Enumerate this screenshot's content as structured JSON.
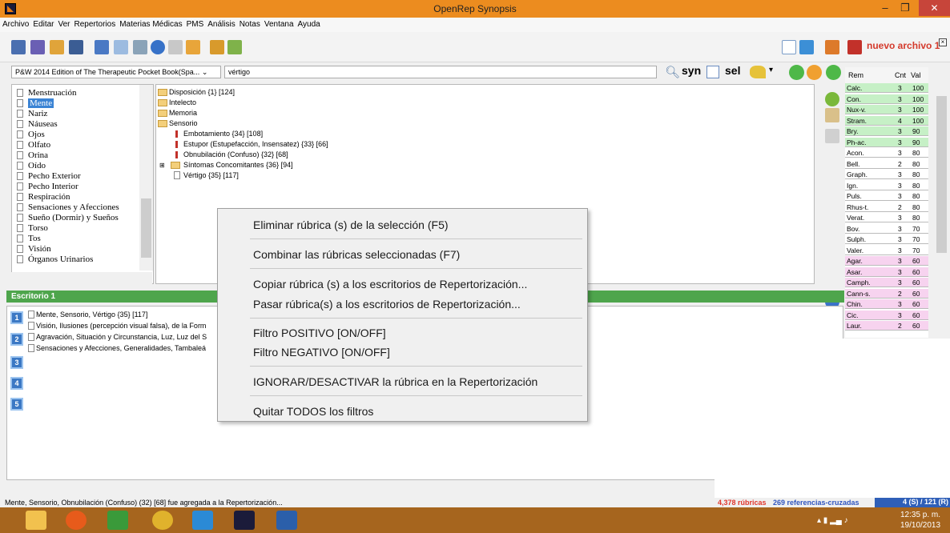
{
  "window": {
    "title": "OpenRep Synopsis",
    "min": "–",
    "max": "❐",
    "close": "✕"
  },
  "menu": [
    "Archivo",
    "Editar",
    "Ver",
    "Repertorios",
    "Materias Médicas",
    "PMS",
    "Análisis",
    "Notas",
    "Ventana",
    "Ayuda"
  ],
  "toolbar": {
    "new_file_label": "nuevo archivo 1"
  },
  "book": {
    "selected": "P&W 2014 Edition of The Therapeutic Pocket Book(Spa...",
    "search_value": "vértigo",
    "syn_label": "syn",
    "sel_label": "sel"
  },
  "chapters": [
    "Menstruación",
    "Mente",
    "Nariz",
    "Náuseas",
    "Ojos",
    "Olfato",
    "Orina",
    "Oído",
    "Pecho Exterior",
    "Pecho Interior",
    "Respiración",
    "Sensaciones y Afecciones",
    "Sueño (Dormir) y Sueños",
    "Torso",
    "Tos",
    "Visión",
    "Órganos Urinarios"
  ],
  "rubrics": [
    "Disposición {1} [124]",
    "Intelecto",
    "Memoria",
    "Sensorio",
    "Embotamiento {34} [108]",
    "Estupor (Estupefacción, Insensatez) {33} [66]",
    "Obnubilación (Confuso) {32} [68]",
    "Síntomas Concomitantes {36} [94]",
    "Vértigo {35} [117]"
  ],
  "remedies": {
    "headers": [
      "Rem",
      "Cnt",
      "Val"
    ],
    "rows": [
      [
        "Calc.",
        "3",
        "100"
      ],
      [
        "Con.",
        "3",
        "100"
      ],
      [
        "Nux-v.",
        "3",
        "100"
      ],
      [
        "Stram.",
        "4",
        "100"
      ],
      [
        "Bry.",
        "3",
        "90"
      ],
      [
        "Ph-ac.",
        "3",
        "90"
      ],
      [
        "Acon.",
        "3",
        "80"
      ],
      [
        "Bell.",
        "2",
        "80"
      ],
      [
        "Graph.",
        "3",
        "80"
      ],
      [
        "Ign.",
        "3",
        "80"
      ],
      [
        "Puls.",
        "3",
        "80"
      ],
      [
        "Rhus-t.",
        "2",
        "80"
      ],
      [
        "Verat.",
        "3",
        "80"
      ],
      [
        "Bov.",
        "3",
        "70"
      ],
      [
        "Sulph.",
        "3",
        "70"
      ],
      [
        "Valer.",
        "3",
        "70"
      ],
      [
        "Agar.",
        "3",
        "60"
      ],
      [
        "Asar.",
        "3",
        "60"
      ],
      [
        "Camph.",
        "3",
        "60"
      ],
      [
        "Cann-s.",
        "2",
        "60"
      ],
      [
        "Chin.",
        "3",
        "60"
      ],
      [
        "Cic.",
        "3",
        "60"
      ],
      [
        "Laur.",
        "2",
        "60"
      ]
    ]
  },
  "desk": {
    "title": "Escritorio 1",
    "tabs": [
      "1",
      "2",
      "3",
      "4",
      "5"
    ],
    "lines": [
      "Mente, Sensorio, Vértigo {35} [117]",
      "Visión, Ilusiones (percepción visual falsa), de la Form",
      "Agravación, Situación y Circunstancia, Luz, Luz del S",
      "Sensaciones y Afecciones, Generalidades, Tambaleá"
    ]
  },
  "context_menu": [
    "Eliminar rúbrica (s) de la selección (F5)",
    "Combinar las rúbricas seleccionadas (F7)",
    "Copiar rúbrica (s) a los escritorios de Repertorización...",
    "Pasar rúbrica(s) a los escritorios de Repertorización...",
    "Filtro POSITIVO [ON/OFF]",
    "Filtro NEGATIVO [ON/OFF]",
    "IGNORAR/DESACTIVAR la rúbrica en la Repertorización",
    "Quitar TODOS los filtros"
  ],
  "status": {
    "message": "Mente, Sensorio, Obnubilación (Confuso) (32) [68] fue agregada a la Repertorización...",
    "rubricas": "4,378 rúbricas",
    "referencias": "269 referencias-cruzadas",
    "count": "4 (S) / 121 (R)"
  },
  "taskbar": {
    "time": "12:35 p. m.",
    "date": "19/10/2013"
  },
  "colors": {
    "titlebar": "#ec8c1f",
    "taskbar": "#a6651e",
    "desk_header": "#4ea54c",
    "remedy_green": "#c6f0c6",
    "remedy_pink": "#f7d3ef"
  }
}
